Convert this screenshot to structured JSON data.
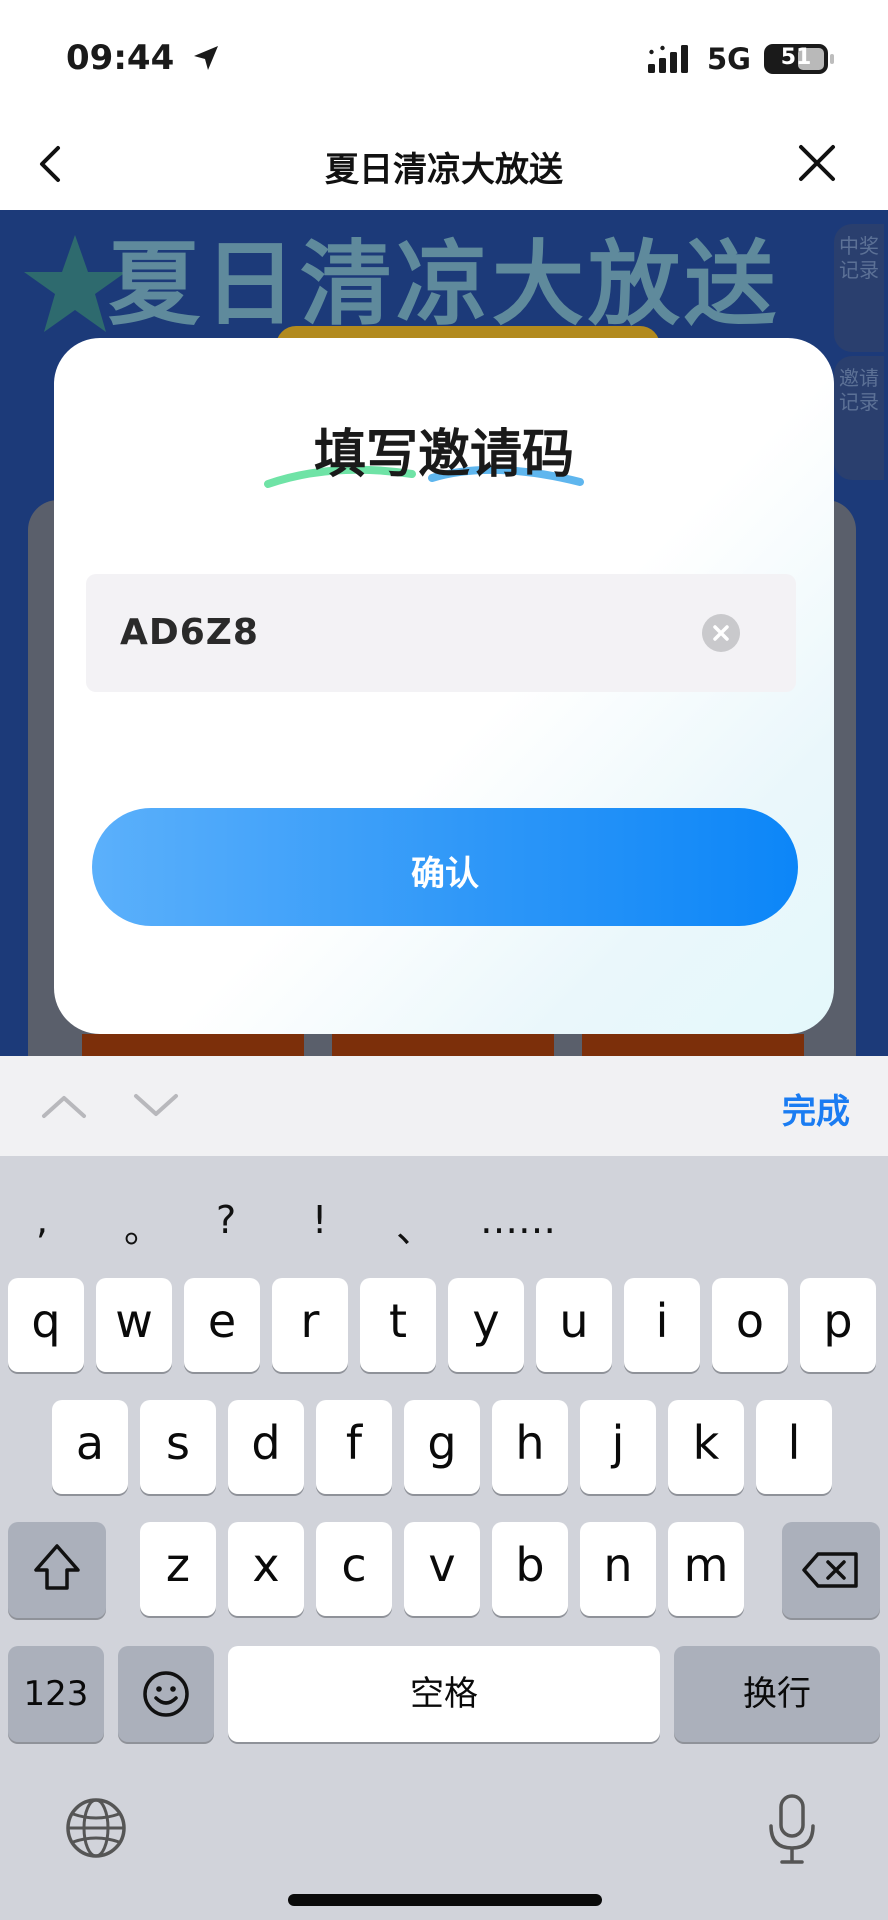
{
  "status_bar": {
    "time": "09:44",
    "network": "5G",
    "battery": "51"
  },
  "nav": {
    "title": "夏日清凉大放送"
  },
  "promo": {
    "banner_title": "夏日清凉大放送",
    "side_tabs": [
      "中奖记录",
      "邀请记录"
    ]
  },
  "modal": {
    "title": "填写邀请码",
    "code_value": "AD6Z8",
    "confirm_label": "确认"
  },
  "accessory": {
    "done_label": "完成"
  },
  "keyboard": {
    "punctuation": [
      ",",
      "。",
      "?",
      "!",
      "、",
      "……"
    ],
    "row1": [
      "q",
      "w",
      "e",
      "r",
      "t",
      "y",
      "u",
      "i",
      "o",
      "p"
    ],
    "row2": [
      "a",
      "s",
      "d",
      "f",
      "g",
      "h",
      "j",
      "k",
      "l"
    ],
    "row3": [
      "z",
      "x",
      "c",
      "v",
      "b",
      "n",
      "m"
    ],
    "numbers_label": "123",
    "space_label": "空格",
    "return_label": "换行"
  },
  "colors": {
    "accent": "#1a7cf2",
    "confirm_start": "#5bb0fb",
    "confirm_end": "#0c86f8",
    "promo_bg": "#1c3a79"
  }
}
